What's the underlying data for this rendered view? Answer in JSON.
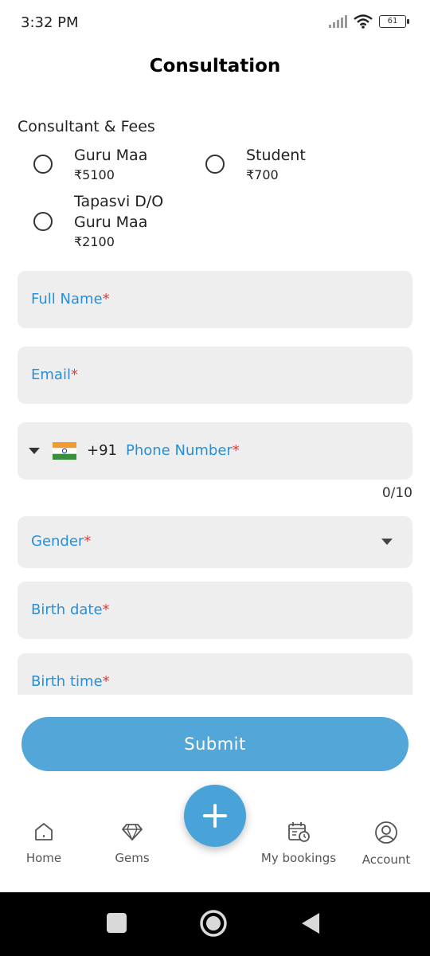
{
  "status": {
    "time": "3:32 PM",
    "battery": "61"
  },
  "header": {
    "title": "Consultation"
  },
  "consultant": {
    "label": "Consultant & Fees",
    "options": [
      {
        "name": "Guru Maa",
        "fee": "₹5100"
      },
      {
        "name": "Student",
        "fee": "₹700"
      },
      {
        "name_line1": "Tapasvi D/O",
        "name_line2": "Guru Maa",
        "fee": "₹2100"
      }
    ]
  },
  "form": {
    "full_name": {
      "label": "Full Name",
      "required": "*"
    },
    "email": {
      "label": "Email",
      "required": "*"
    },
    "phone": {
      "country_code": "+91",
      "label": "Phone Number",
      "required": "*",
      "counter": "0/10"
    },
    "gender": {
      "label": "Gender",
      "required": "*"
    },
    "birth_date": {
      "label": "Birth date",
      "required": "*"
    },
    "birth_time": {
      "label": "Birth time",
      "required": "*"
    }
  },
  "submit": {
    "label": "Submit"
  },
  "nav": {
    "items": [
      {
        "label": "Home",
        "icon": "home-icon"
      },
      {
        "label": "Gems",
        "icon": "diamond-icon"
      },
      {
        "label": "My bookings",
        "icon": "calendar-clock-icon"
      },
      {
        "label": "Account",
        "icon": "account-icon"
      }
    ],
    "fab_icon": "plus-icon"
  },
  "colors": {
    "accent": "#2a8fd7",
    "button": "#52a6d8",
    "fab": "#4aa3d8",
    "required": "#e53935",
    "field_bg": "#eeeeee"
  }
}
